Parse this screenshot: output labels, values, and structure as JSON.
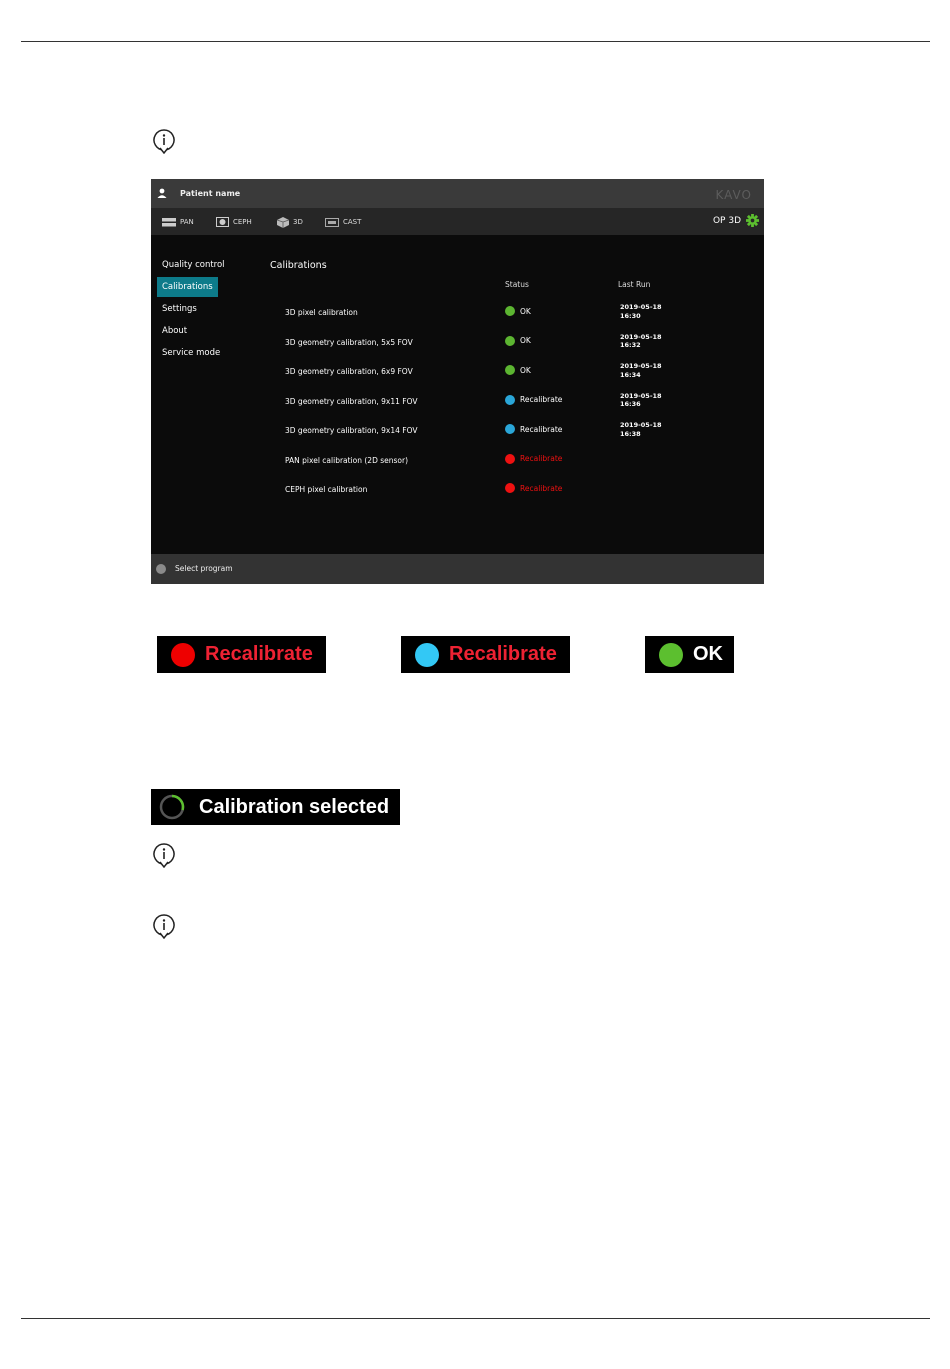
{
  "window": {
    "patient_name": "Patient name",
    "brand": "KAVO",
    "device": "OP 3D"
  },
  "programs": [
    {
      "label": "PAN",
      "icon": "pan-icon"
    },
    {
      "label": "CEPH",
      "icon": "ceph-icon"
    },
    {
      "label": "3D",
      "icon": "cube-icon"
    },
    {
      "label": "CAST",
      "icon": "cast-icon"
    }
  ],
  "sidebar": {
    "items": [
      {
        "label": "Quality control",
        "active": false
      },
      {
        "label": "Calibrations",
        "active": true
      },
      {
        "label": "Settings",
        "active": false
      },
      {
        "label": "About",
        "active": false
      },
      {
        "label": "Service mode",
        "active": false
      }
    ]
  },
  "main": {
    "title": "Calibrations",
    "columns": {
      "status": "Status",
      "last_run": "Last Run"
    },
    "rows": [
      {
        "name": "3D pixel calibration",
        "status": "OK",
        "color": "#5cb531",
        "date": "2019-05-18",
        "time": "16:30"
      },
      {
        "name": "3D geometry calibration, 5x5 FOV",
        "status": "OK",
        "color": "#5cb531",
        "date": "2019-05-18",
        "time": "16:32"
      },
      {
        "name": "3D geometry calibration, 6x9 FOV",
        "status": "OK",
        "color": "#5cb531",
        "date": "2019-05-18",
        "time": "16:34"
      },
      {
        "name": "3D geometry calibration, 9x11 FOV",
        "status": "Recalibrate",
        "color": "#2aa6d8",
        "date": "2019-05-18",
        "time": "16:36"
      },
      {
        "name": "3D geometry calibration, 9x14 FOV",
        "status": "Recalibrate",
        "color": "#2aa6d8",
        "date": "2019-05-18",
        "time": "16:38"
      },
      {
        "name": "PAN pixel calibration (2D sensor)",
        "status": "Recalibrate",
        "color": "#ee1111",
        "date": "",
        "time": ""
      },
      {
        "name": "CEPH pixel calibration",
        "status": "Recalibrate",
        "color": "#ee1111",
        "date": "",
        "time": ""
      }
    ]
  },
  "statusbar": {
    "label": "Select program"
  },
  "legend": [
    {
      "label": "Recalibrate",
      "dot_color": "#ee0000",
      "text_color": "#ee2233"
    },
    {
      "label": "Recalibrate",
      "dot_color": "#33c8f5",
      "text_color": "#ee2233"
    },
    {
      "label": "OK",
      "dot_color": "#5cbf2f",
      "text_color": "#ffffff"
    }
  ],
  "selected_badge": {
    "label": "Calibration selected",
    "accent": "#5cbf2f"
  }
}
